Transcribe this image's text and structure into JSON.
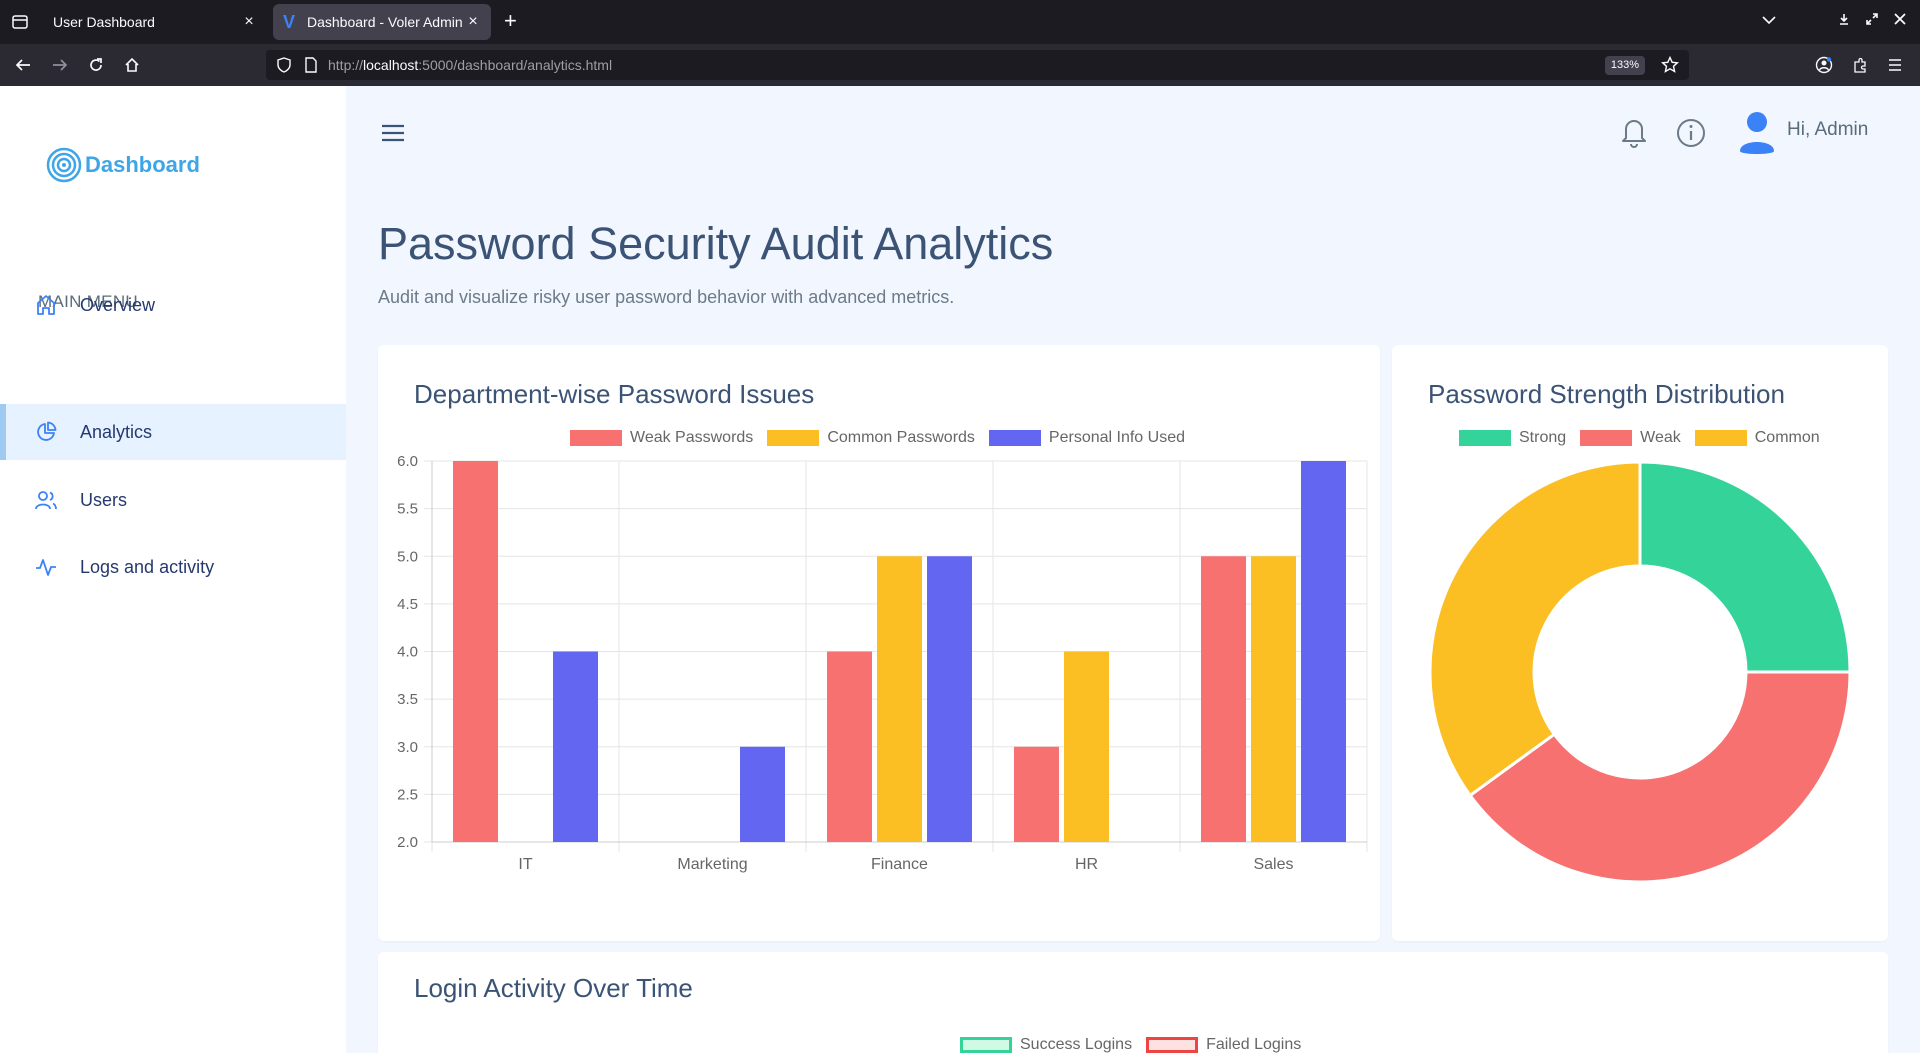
{
  "browser": {
    "tabs": [
      {
        "title": "User Dashboard"
      },
      {
        "title": "Dashboard - Voler Admin D"
      }
    ],
    "url_prefix": "http://",
    "url_host": "localhost",
    "url_rest": ":5000/dashboard/analytics.html",
    "zoom": "133%"
  },
  "sidebar": {
    "brand": "Dashboard",
    "menu_title": "MAIN MENU",
    "items": [
      {
        "label": "Overview",
        "icon": "home-icon"
      },
      {
        "label": "Analytics",
        "icon": "pie-chart-icon",
        "active": true
      },
      {
        "label": "Users",
        "icon": "users-icon"
      },
      {
        "label": "Logs and activity",
        "icon": "activity-icon"
      }
    ]
  },
  "topbar": {
    "greeting": "Hi, Admin"
  },
  "page": {
    "title": "Password Security Audit Analytics",
    "subtitle": "Audit and visualize risky user password behavior with advanced metrics."
  },
  "cards": {
    "dept_title": "Department-wise Password Issues",
    "strength_title": "Password Strength Distribution",
    "login_title": "Login Activity Over Time"
  },
  "colors": {
    "red": "#f87171",
    "yellow": "#fbbf24",
    "indigo": "#6366f1",
    "green": "#34d399"
  },
  "chart_data": [
    {
      "type": "bar",
      "title": "Department-wise Password Issues",
      "categories": [
        "IT",
        "Marketing",
        "Finance",
        "HR",
        "Sales"
      ],
      "series": [
        {
          "name": "Weak Passwords",
          "values": [
            6,
            2,
            4,
            3,
            5
          ],
          "color": "#f87171"
        },
        {
          "name": "Common Passwords",
          "values": [
            2,
            2,
            5,
            4,
            5
          ],
          "color": "#fbbf24"
        },
        {
          "name": "Personal Info Used",
          "values": [
            4,
            3,
            5,
            2,
            6
          ],
          "color": "#6366f1"
        }
      ],
      "ylim": [
        2,
        6
      ],
      "yticks": [
        "6.0",
        "5.5",
        "5.0",
        "4.5",
        "4.0",
        "3.5",
        "3.0",
        "2.5",
        "2.0"
      ],
      "legend": "top",
      "grid": true
    },
    {
      "type": "pie",
      "title": "Password Strength Distribution",
      "labels": [
        "Strong",
        "Weak",
        "Common"
      ],
      "values": [
        25,
        40,
        35
      ],
      "colors": [
        "#34d399",
        "#f87171",
        "#fbbf24"
      ],
      "donut": true,
      "legend": "top"
    },
    {
      "type": "line",
      "title": "Login Activity Over Time",
      "series": [
        {
          "name": "Success Logins",
          "color": "#34d399"
        },
        {
          "name": "Failed Logins",
          "color": "#ef4444"
        }
      ],
      "legend": "top"
    }
  ]
}
